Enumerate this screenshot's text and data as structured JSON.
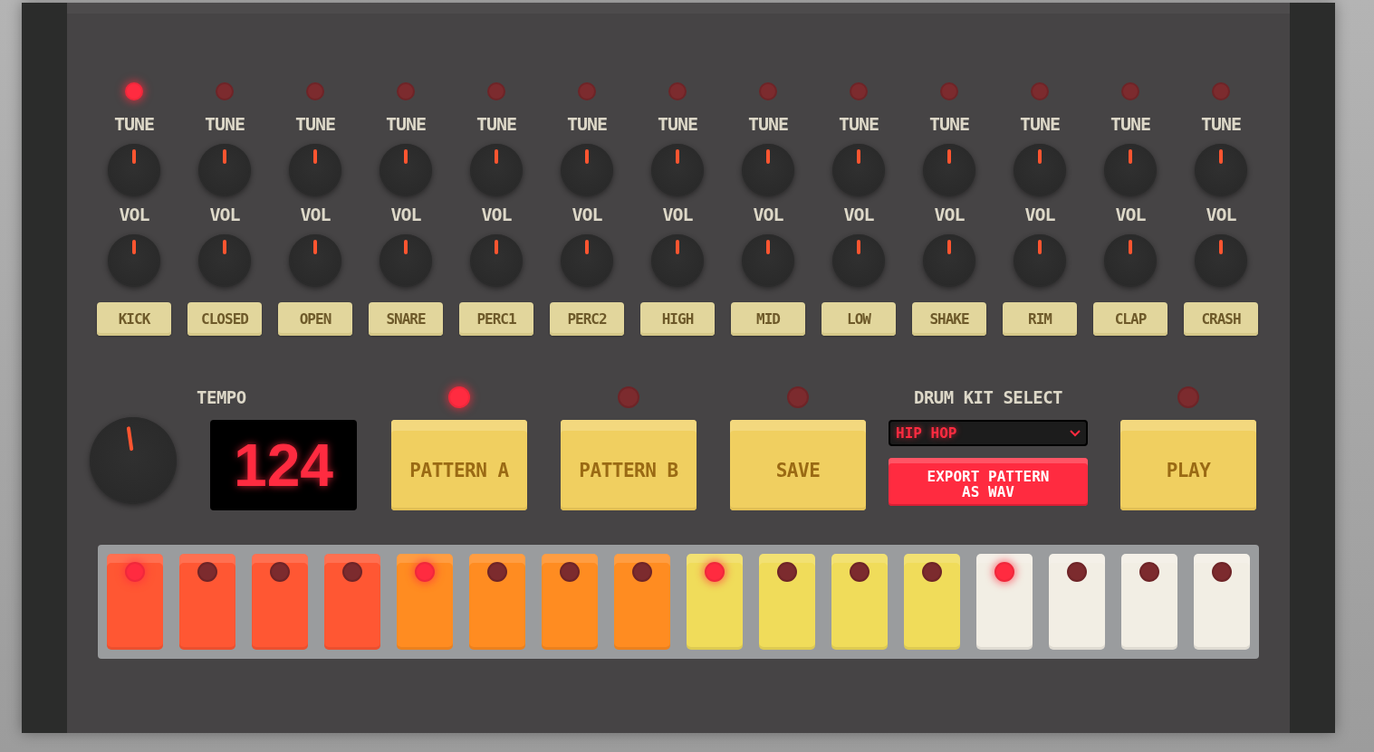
{
  "channels": [
    {
      "name": "KICK",
      "led_on": true,
      "tune": {
        "label": "TUNE",
        "level": 0.5
      },
      "vol": {
        "label": "VOL",
        "level": 0.5
      }
    },
    {
      "name": "CLOSED",
      "led_on": false,
      "tune": {
        "label": "TUNE",
        "level": 0.5
      },
      "vol": {
        "label": "VOL",
        "level": 0.5
      }
    },
    {
      "name": "OPEN",
      "led_on": false,
      "tune": {
        "label": "TUNE",
        "level": 0.5
      },
      "vol": {
        "label": "VOL",
        "level": 0.5
      }
    },
    {
      "name": "SNARE",
      "led_on": false,
      "tune": {
        "label": "TUNE",
        "level": 0.5
      },
      "vol": {
        "label": "VOL",
        "level": 0.5
      }
    },
    {
      "name": "PERC1",
      "led_on": false,
      "tune": {
        "label": "TUNE",
        "level": 0.5
      },
      "vol": {
        "label": "VOL",
        "level": 0.5
      }
    },
    {
      "name": "PERC2",
      "led_on": false,
      "tune": {
        "label": "TUNE",
        "level": 0.5
      },
      "vol": {
        "label": "VOL",
        "level": 0.5
      }
    },
    {
      "name": "HIGH",
      "led_on": false,
      "tune": {
        "label": "TUNE",
        "level": 0.5
      },
      "vol": {
        "label": "VOL",
        "level": 0.5
      }
    },
    {
      "name": "MID",
      "led_on": false,
      "tune": {
        "label": "TUNE",
        "level": 0.5
      },
      "vol": {
        "label": "VOL",
        "level": 0.5
      }
    },
    {
      "name": "LOW",
      "led_on": false,
      "tune": {
        "label": "TUNE",
        "level": 0.5
      },
      "vol": {
        "label": "VOL",
        "level": 0.5
      }
    },
    {
      "name": "SHAKE",
      "led_on": false,
      "tune": {
        "label": "TUNE",
        "level": 0.5
      },
      "vol": {
        "label": "VOL",
        "level": 0.5
      }
    },
    {
      "name": "RIM",
      "led_on": false,
      "tune": {
        "label": "TUNE",
        "level": 0.5
      },
      "vol": {
        "label": "VOL",
        "level": 0.5
      }
    },
    {
      "name": "CLAP",
      "led_on": false,
      "tune": {
        "label": "TUNE",
        "level": 0.5
      },
      "vol": {
        "label": "VOL",
        "level": 0.5
      }
    },
    {
      "name": "CRASH",
      "led_on": false,
      "tune": {
        "label": "TUNE",
        "level": 0.5
      },
      "vol": {
        "label": "VOL",
        "level": 0.5
      }
    }
  ],
  "tempo": {
    "label": "TEMPO",
    "level": 0.47,
    "display": "124"
  },
  "transport": [
    {
      "kind": "button",
      "label": "PATTERN A",
      "led_on": true
    },
    {
      "kind": "button",
      "label": "PATTERN B",
      "led_on": false
    },
    {
      "kind": "button",
      "label": "SAVE",
      "led_on": false
    },
    {
      "kind": "kit",
      "label": "DRUM KIT SELECT",
      "value": "HIP HOP",
      "export": "EXPORT PATTERN AS WAV"
    },
    {
      "kind": "button",
      "label": "PLAY",
      "led_on": false
    }
  ],
  "steps": [
    {
      "color": "#ff5733",
      "on": true
    },
    {
      "color": "#ff5733",
      "on": false
    },
    {
      "color": "#ff5733",
      "on": false
    },
    {
      "color": "#ff5733",
      "on": false
    },
    {
      "color": "#ff8c21",
      "on": true
    },
    {
      "color": "#ff8c21",
      "on": false
    },
    {
      "color": "#ff8c21",
      "on": false
    },
    {
      "color": "#ff8c21",
      "on": false
    },
    {
      "color": "#f0dc5a",
      "on": true
    },
    {
      "color": "#f0dc5a",
      "on": false
    },
    {
      "color": "#f0dc5a",
      "on": false
    },
    {
      "color": "#f0dc5a",
      "on": false
    },
    {
      "color": "#f2eee4",
      "on": true
    },
    {
      "color": "#f2eee4",
      "on": false
    },
    {
      "color": "#f2eee4",
      "on": false
    },
    {
      "color": "#f2eee4",
      "on": false
    }
  ]
}
